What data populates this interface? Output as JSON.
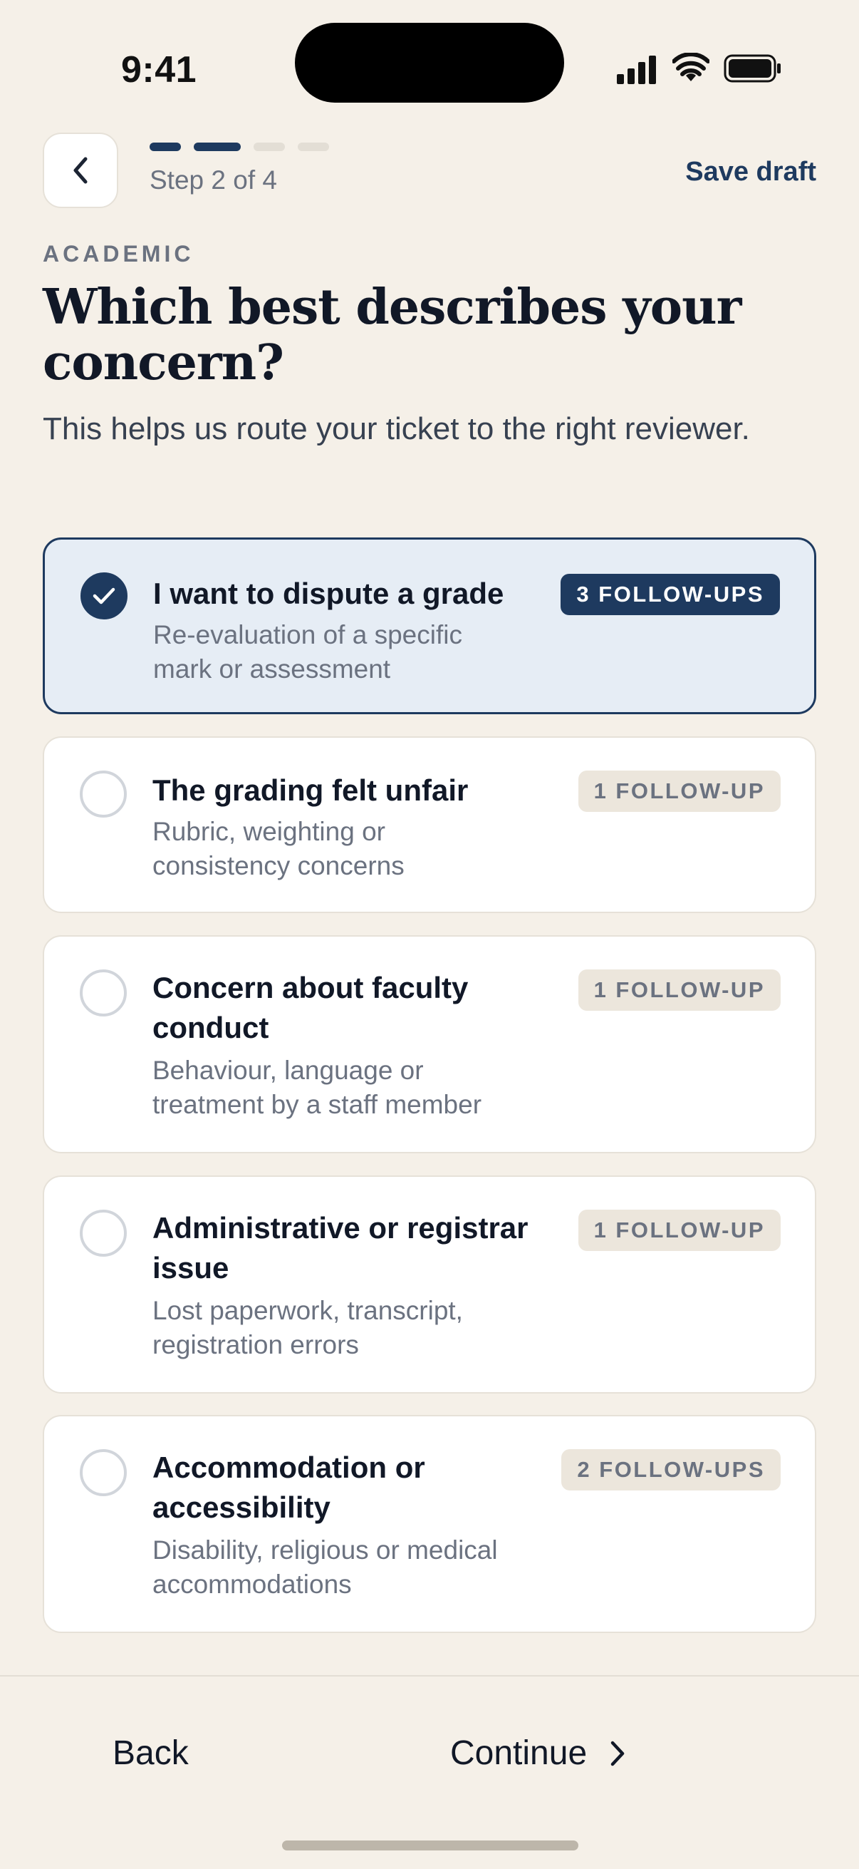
{
  "status_bar": {
    "time": "9:41"
  },
  "header": {
    "step_label": "Step 2 of 4",
    "save_draft": "Save draft",
    "progress": {
      "current_step": 2,
      "total_steps": 4
    }
  },
  "section": {
    "eyebrow": "ACADEMIC",
    "title": "Which best describes your concern?",
    "subtitle": "This helps us route your ticket to the right reviewer."
  },
  "options": [
    {
      "title": "I want to dispute a grade",
      "description": "Re-evaluation of a specific mark or assessment",
      "badge": "3 FOLLOW-UPS",
      "selected": true
    },
    {
      "title": "The grading felt unfair",
      "description": "Rubric, weighting or consistency concerns",
      "badge": "1 FOLLOW-UP",
      "selected": false
    },
    {
      "title": "Concern about faculty conduct",
      "description": "Behaviour, language or treatment by a staff member",
      "badge": "1 FOLLOW-UP",
      "selected": false
    },
    {
      "title": "Administrative or registrar issue",
      "description": "Lost paperwork, transcript, registration errors",
      "badge": "1 FOLLOW-UP",
      "selected": false
    },
    {
      "title": "Accommodation or accessibility",
      "description": "Disability, religious or medical accommodations",
      "badge": "2 FOLLOW-UPS",
      "selected": false
    }
  ],
  "footer": {
    "back_label": "Back",
    "continue_label": "Continue"
  },
  "colors": {
    "accent": "#1e3a5f",
    "background": "#f5f0e8",
    "selected_background": "#e6edf5"
  }
}
